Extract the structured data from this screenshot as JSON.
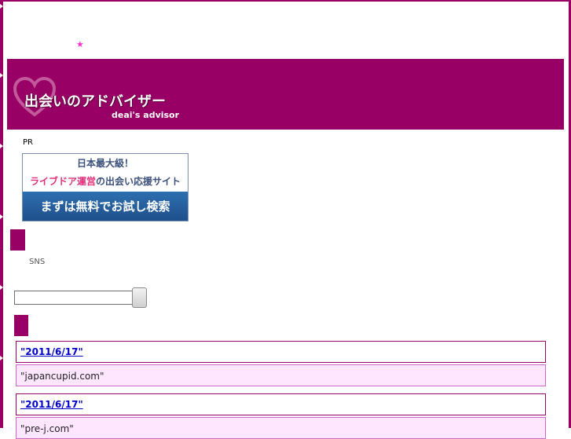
{
  "site": {
    "star": "★",
    "logo_main": "出会いのアドバイザー",
    "logo_sub": "deai's advisor"
  },
  "pr_label": "PR",
  "ad": {
    "line1": "日本最大級！",
    "line2_highlight": "ライブドア運営",
    "line2_rest": "の出会い応援サイト",
    "button": "まずは無料でお試し検索"
  },
  "sns_label": "SNS",
  "search": {
    "value": "",
    "button_label": ""
  },
  "entries": [
    {
      "date": "\"2011/6/17\"",
      "site": "\"japancupid.com\""
    },
    {
      "date": "\"2011/6/17\"",
      "site": "\"pre-j.com\""
    }
  ],
  "colors": {
    "brand": "#990066",
    "entry_bg": "#ffe6ff",
    "link": "#0000cc",
    "ad_button": "#1d4f8a"
  }
}
